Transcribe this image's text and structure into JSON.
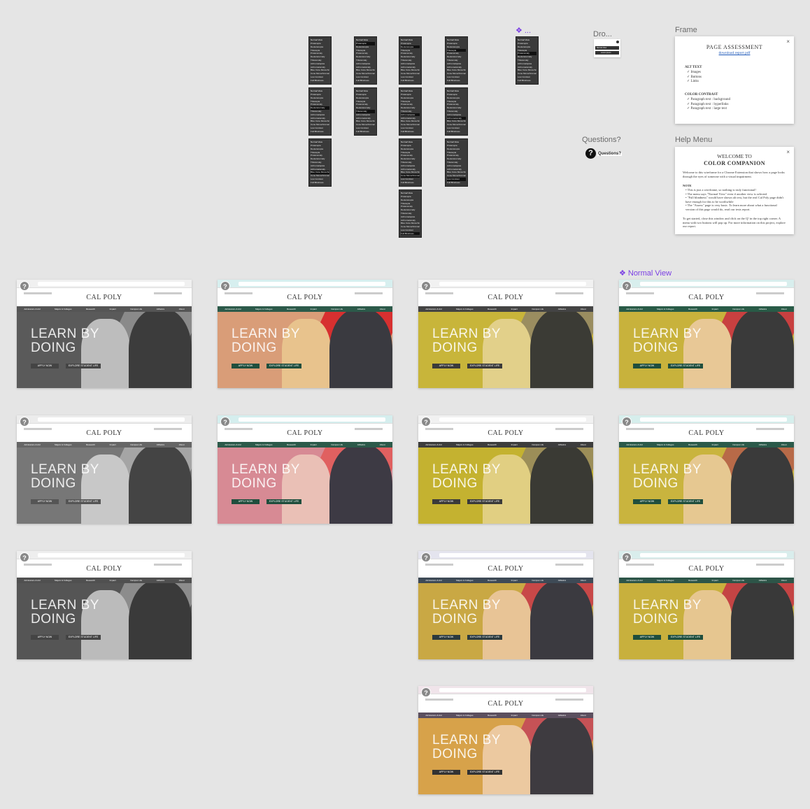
{
  "canvas": {
    "background": "#e5e5e5"
  },
  "labels": {
    "dropdown": "Dro...",
    "component_ellipsis": "...",
    "frame": "Frame",
    "questions": "Questions?",
    "help_menu": "Help Menu",
    "normal_view": "Normal View"
  },
  "questions_button": {
    "icon": "?",
    "label": "Questions?"
  },
  "dropdown_mini": {
    "item1": "Normal View",
    "item2": "Lorem ipsum"
  },
  "menu_items": [
    "Normal View",
    "Protanopia",
    "Deuteranopia",
    "Tritanopia",
    "Protanomaly",
    "Deuteranomaly",
    "Tritanomaly",
    "Achromatopsia",
    "Achromatomaly",
    "Blue Cone Monochromacy",
    "Cone Monochromacy",
    "Low Contrast",
    "Full Blindness"
  ],
  "page_assessment": {
    "title": "PAGE ASSESSMENT",
    "link": "download report pdf",
    "alt_heading": "ALT TEXT",
    "alt_items": [
      "Images",
      "Buttons",
      "Links"
    ],
    "contrast_heading": "COLOR CONTRAST",
    "contrast_items": [
      "Paragraph text : background",
      "Paragraph text : hyperlinks",
      "Paragraph text : large text"
    ]
  },
  "help": {
    "welcome": "WELCOME TO",
    "title": "COLOR COMPANION",
    "intro": "Welcome to this wireframe for a Chrome Extension that shows how a page looks through the eyes of someone with a visual impairment.",
    "note_heading": "NOTE",
    "notes": [
      "This is just a wireframe, so nothing is truly functional!",
      "The menu says \"Normal View\" even if another view is selected",
      "\"Full blindness\" would have shown alt text, but the real Cal Poly page didn't have enough for this to be worthwhile",
      "The \"Assess\" page is very basic. To learn more about what a functional version of this page would do, read our tests report."
    ],
    "get_started": "To get started, close this window and click on the Q! in the top right corner. A menu with two buttons will pop up. For more information on this project, explore our report."
  },
  "site": {
    "logo": "CAL POLY",
    "headline_line1": "LEARN BY",
    "headline_line2": "DOING",
    "apply_button": "APPLY NOW",
    "explore_button": "EXPLORE STUDENT LIFE",
    "nav": [
      "Admissions & Aid",
      "Majors & Colleges",
      "Research",
      "Impact",
      "Campus Life",
      "Athletics",
      "About"
    ]
  },
  "thumbnails": [
    {
      "name": "grayscale",
      "nav": "#555555",
      "hero": "#5a5a5a",
      "stripe": "#8a8a8a",
      "p1": "#bdbdbd",
      "p2": "#3c3c3c",
      "btn": "#444444",
      "browser": "#f0f0f0"
    },
    {
      "name": "protanopia",
      "nav": "#2c5a4a",
      "hero": "#d99d78",
      "stripe": "#d73030",
      "p1": "#e8c38d",
      "p2": "#3a3a40",
      "btn": "#1f4e3d",
      "browser": "#d7efef"
    },
    {
      "name": "deuteranopia",
      "nav": "#444444",
      "hero": "#c8b53a",
      "stripe": "#9a8d60",
      "p1": "#e2d08a",
      "p2": "#3b3b35",
      "btn": "#3a3a3a",
      "browser": "#f1f1f1"
    },
    {
      "name": "normal",
      "nav": "#295b47",
      "hero": "#c8b23c",
      "stripe": "#c84040",
      "p1": "#e8c896",
      "p2": "#3a3a3a",
      "btn": "#1f4e3d",
      "browser": "#d8eeed"
    },
    {
      "name": "achromatomaly",
      "nav": "#666666",
      "hero": "#777777",
      "stripe": "#a5a5a5",
      "p1": "#c8c8c8",
      "p2": "#444444",
      "btn": "#555555",
      "browser": "#ececec"
    },
    {
      "name": "tritanopia",
      "nav": "#2c5a4a",
      "hero": "#d78a94",
      "stripe": "#e06060",
      "p1": "#eac0b6",
      "p2": "#3d3a44",
      "btn": "#1f4e3d",
      "browser": "#d5eeee"
    },
    {
      "name": "deuteranomaly",
      "nav": "#3d3d3d",
      "hero": "#c4b230",
      "stripe": "#9c8e58",
      "p1": "#e1cf82",
      "p2": "#3a3a34",
      "btn": "#3a3a3a",
      "browser": "#f1f1f1"
    },
    {
      "name": "protanomaly",
      "nav": "#2b5a4a",
      "hero": "#c9b43e",
      "stripe": "#b86a48",
      "p1": "#e6c891",
      "p2": "#3a3a3a",
      "btn": "#1f4e3d",
      "browser": "#d6eeec"
    },
    {
      "name": "monochromacy",
      "nav": "#505050",
      "hero": "#555555",
      "stripe": "#8c8c8c",
      "p1": "#bbbbbb",
      "p2": "#3a3a3a",
      "btn": "#444444",
      "browser": "#eeeeee"
    },
    {
      "name": "tritanomaly",
      "nav": "#3e4a56",
      "hero": "#c9a844",
      "stripe": "#c84848",
      "p1": "#e8c496",
      "p2": "#3b3a40",
      "btn": "#2b3a3e",
      "browser": "#e4e4ee"
    },
    {
      "name": "blue-cone",
      "nav": "#2d5548",
      "hero": "#c8b03d",
      "stripe": "#c44444",
      "p1": "#e6c690",
      "p2": "#393939",
      "btn": "#1f4e3d",
      "browser": "#d9edec"
    },
    {
      "name": "low-contrast",
      "nav": "#5b4f5f",
      "hero": "#d7a24a",
      "stripe": "#c65256",
      "p1": "#ecc9a0",
      "p2": "#3e3b40",
      "btn": "#333333",
      "browser": "#f0e4ea"
    }
  ]
}
